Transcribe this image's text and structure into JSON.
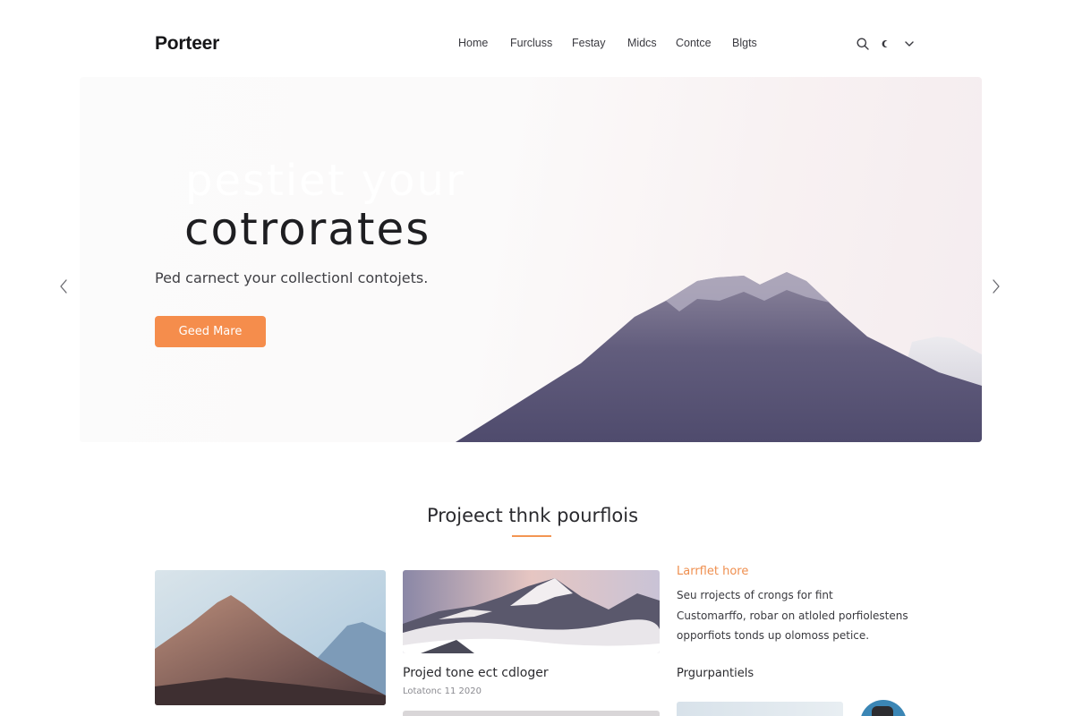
{
  "header": {
    "logo": "Porteer",
    "nav": [
      "Home",
      "Furcluss",
      "Festay",
      "Midcs",
      "Contce",
      "Blgts"
    ],
    "icons": [
      "search-icon",
      "moon-icon",
      "chevron-down-icon"
    ]
  },
  "hero": {
    "faded_line": "pestiet your",
    "title": "cotrorates",
    "subtitle": "Ped carnect your collectionl contojets.",
    "button_label": "Geed Mare"
  },
  "section": {
    "title": "Projeect thnk pourflois"
  },
  "cards": {
    "card2_title": "Projed tone ect cdloger",
    "card2_meta": "Lotatonc 11 2020"
  },
  "sidebar": {
    "heading": "Larrflet hore",
    "lines": [
      "Seu rrojects of crongs for fint",
      "Customarffo, robar on atloled porfiolestens",
      "opporfiots tonds up olomoss petice."
    ],
    "subheading": "Prgurpantiels"
  },
  "colors": {
    "accent": "#f58d4c",
    "mountain": "#5b5677",
    "text": "#1e1e21"
  }
}
